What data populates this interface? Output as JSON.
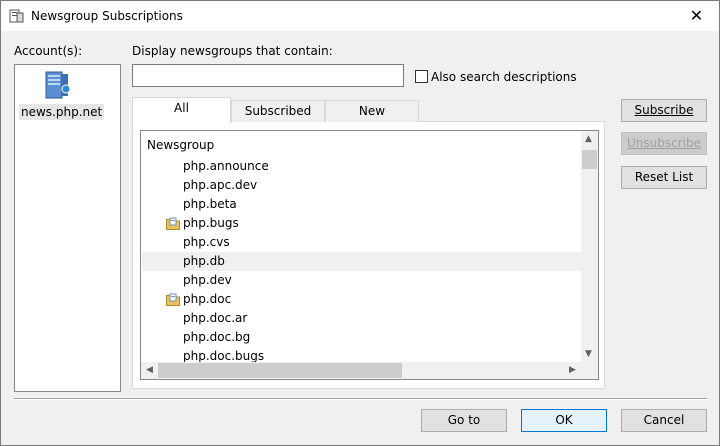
{
  "window": {
    "title": "Newsgroup Subscriptions",
    "close_glyph": "✕"
  },
  "accounts": {
    "label": "Account(s):",
    "items": [
      {
        "label": "news.php.net"
      }
    ]
  },
  "search": {
    "label": "Display newsgroups that contain:",
    "value": "",
    "placeholder": "",
    "also_descriptions_label": "Also search descriptions",
    "also_descriptions_checked": false
  },
  "tabs": [
    {
      "label": "All",
      "active": true
    },
    {
      "label": "Subscribed",
      "active": false
    },
    {
      "label": "New",
      "active": false
    }
  ],
  "list": {
    "column_header": "Newsgroup",
    "rows": [
      {
        "name": "php.announce",
        "subscribed": false,
        "selected": false
      },
      {
        "name": "php.apc.dev",
        "subscribed": false,
        "selected": false
      },
      {
        "name": "php.beta",
        "subscribed": false,
        "selected": false
      },
      {
        "name": "php.bugs",
        "subscribed": true,
        "selected": false
      },
      {
        "name": "php.cvs",
        "subscribed": false,
        "selected": false
      },
      {
        "name": "php.db",
        "subscribed": false,
        "selected": true
      },
      {
        "name": "php.dev",
        "subscribed": false,
        "selected": false
      },
      {
        "name": "php.doc",
        "subscribed": true,
        "selected": false
      },
      {
        "name": "php.doc.ar",
        "subscribed": false,
        "selected": false
      },
      {
        "name": "php.doc.bg",
        "subscribed": false,
        "selected": false
      },
      {
        "name": "php.doc.bugs",
        "subscribed": false,
        "selected": false
      }
    ]
  },
  "side_buttons": {
    "subscribe": "Subscribe",
    "unsubscribe": "Unsubscribe",
    "reset_list": "Reset List"
  },
  "bottom_buttons": {
    "goto": "Go to",
    "ok": "OK",
    "cancel": "Cancel"
  },
  "colors": {
    "accent": "#0078d7",
    "folder": "#e8c25a",
    "server_icon": "#3b7fc4"
  },
  "icons": {
    "window": "newsgroup-window-icon",
    "account": "news-server-icon",
    "subscribed": "subscribed-folder-icon"
  }
}
